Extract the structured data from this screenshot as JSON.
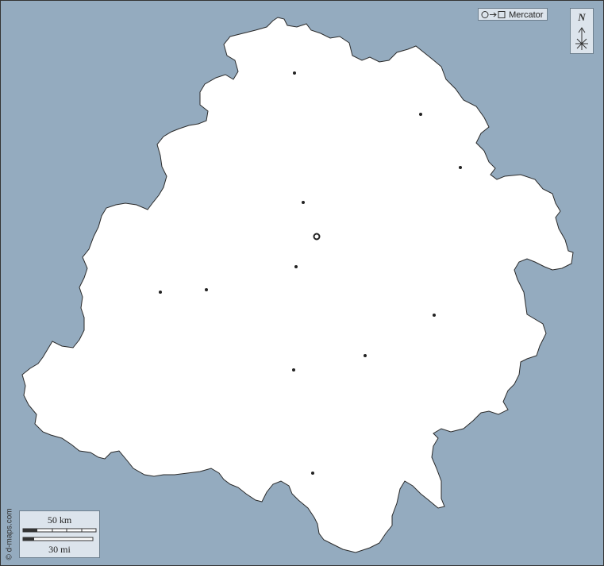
{
  "projection": {
    "label": "Mercator",
    "symbol": "○→□"
  },
  "north_arrow": {
    "letter": "N"
  },
  "scale_bar": {
    "km_label": "50 km",
    "mi_label": "30 mi"
  },
  "credit": "© d-maps.com",
  "colors": {
    "sea": "#94abbf",
    "land": "#ffffff",
    "border": "#333333",
    "panel": "#dce4ec"
  },
  "map": {
    "capital_marker": "ring",
    "town_markers": 12
  }
}
